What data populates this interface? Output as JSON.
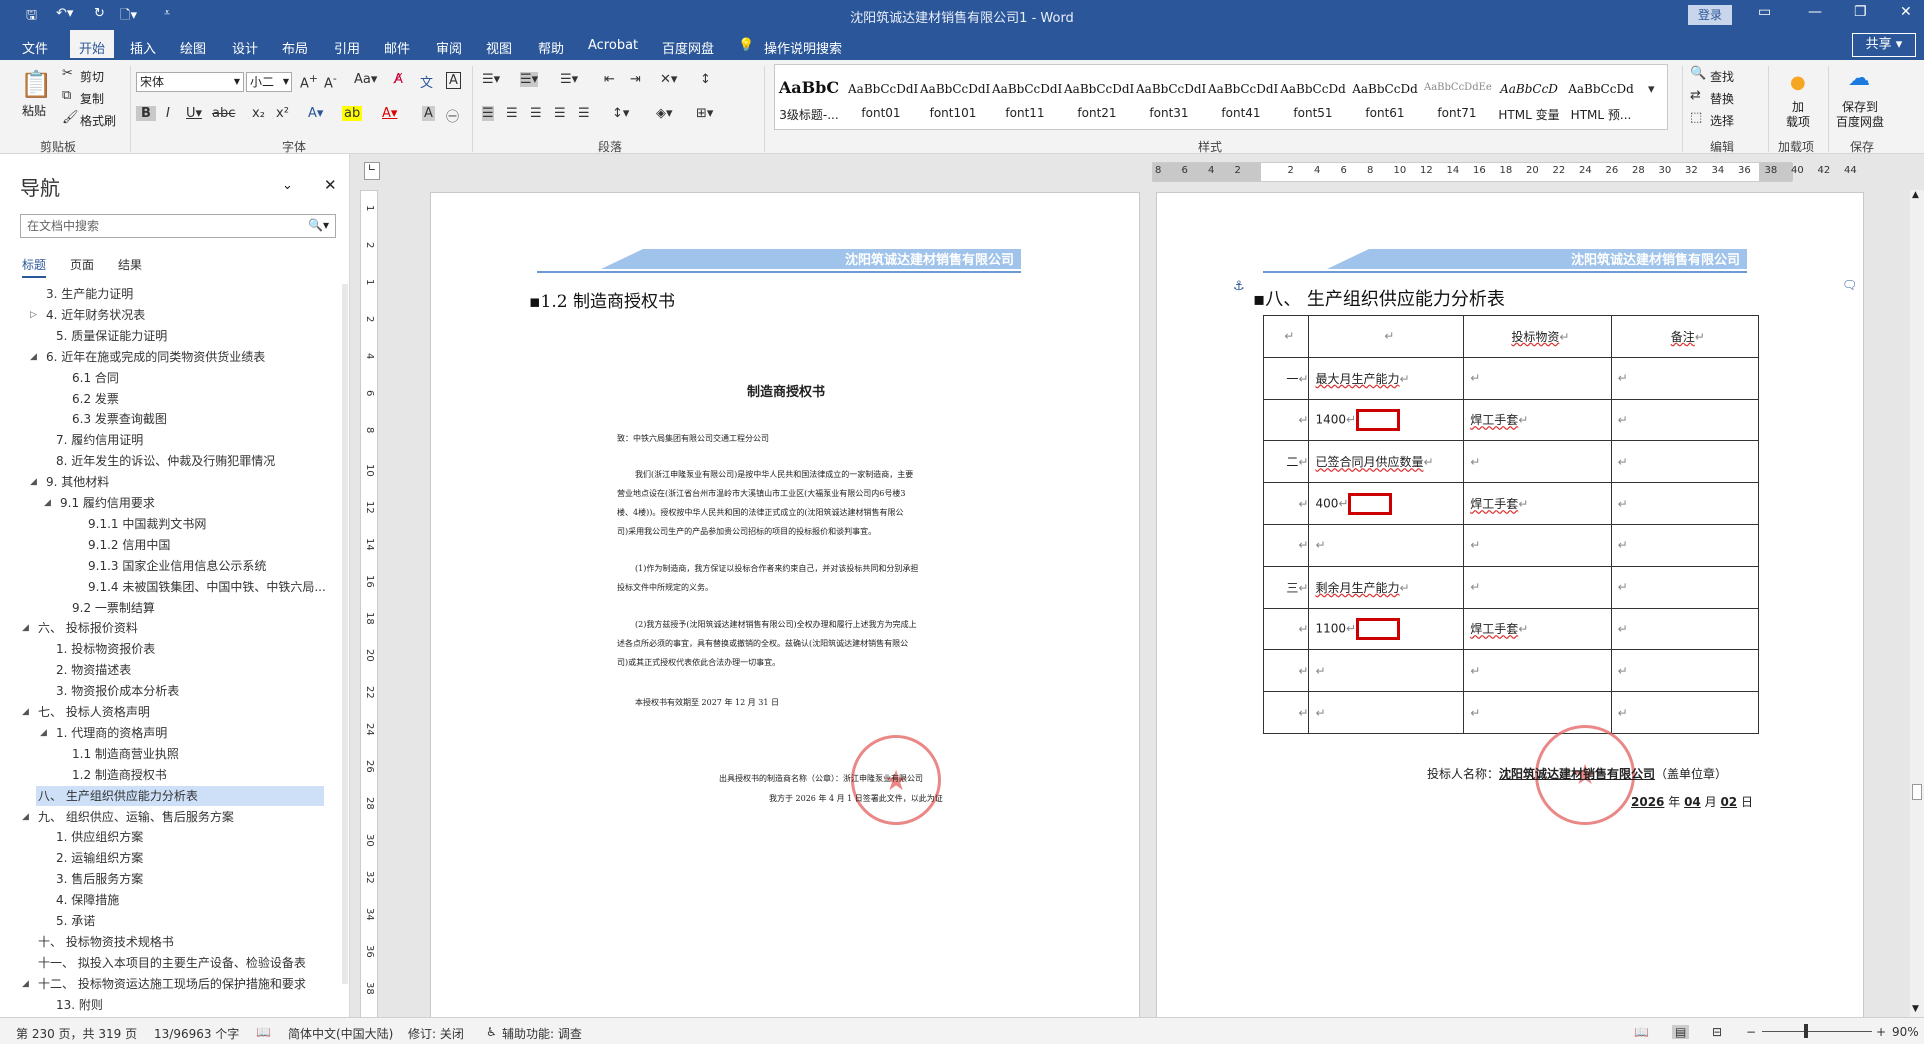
{
  "window": {
    "title": "沈阳筑诚达建材销售有限公司1 - Word",
    "login": "登录"
  },
  "tabs": [
    "文件",
    "开始",
    "插入",
    "绘图",
    "设计",
    "布局",
    "引用",
    "邮件",
    "审阅",
    "视图",
    "帮助",
    "Acrobat",
    "百度网盘"
  ],
  "tell_me": "操作说明搜索",
  "share": "共享",
  "ribbon": {
    "clipboard": {
      "paste": "粘贴",
      "cut": "剪切",
      "copy": "复制",
      "format_painter": "格式刷",
      "label": "剪贴板"
    },
    "font": {
      "name": "宋体",
      "size": "小二",
      "label": "字体"
    },
    "paragraph": {
      "label": "段落"
    },
    "styles": {
      "label": "样式",
      "items": [
        {
          "preview": "AaBbC",
          "name": "3级标题-..."
        },
        {
          "preview": "AaBbCcDdI",
          "name": "font01"
        },
        {
          "preview": "AaBbCcDdI",
          "name": "font101"
        },
        {
          "preview": "AaBbCcDdI",
          "name": "font11"
        },
        {
          "preview": "AaBbCcDdI",
          "name": "font21"
        },
        {
          "preview": "AaBbCcDdI",
          "name": "font31"
        },
        {
          "preview": "AaBbCcDdI",
          "name": "font41"
        },
        {
          "preview": "AaBbCcDd",
          "name": "font51"
        },
        {
          "preview": "AaBbCcDd",
          "name": "font61"
        },
        {
          "preview": "AaBbCcDdEe",
          "name": "font71"
        },
        {
          "preview": "AaBbCcD",
          "name": "HTML 变量"
        },
        {
          "preview": "AaBbCcDd",
          "name": "HTML 预..."
        }
      ]
    },
    "editing": {
      "find": "查找",
      "replace": "替换",
      "select": "选择",
      "label": "编辑"
    },
    "addins": {
      "load": "加\n载项",
      "label": "加载项"
    },
    "save": {
      "save_to_baidu": "保存到\n百度网盘",
      "label": "保存"
    }
  },
  "nav": {
    "title": "导航",
    "search_placeholder": "在文档中搜索",
    "tabs": [
      "标题",
      "页面",
      "结果"
    ],
    "items": [
      "3. 生产能力证明",
      "4. 近年财务状况表",
      "5. 质量保证能力证明",
      "6. 近年在施或完成的同类物资供货业绩表",
      "6.1 合同",
      "6.2 发票",
      "6.3 发票查询截图",
      "7. 履约信用证明",
      "8. 近年发生的诉讼、仲裁及行贿犯罪情况",
      "9. 其他材料",
      "9.1 履约信用要求",
      "9.1.1 中国裁判文书网",
      "9.1.2 信用中国",
      "9.1.3 国家企业信用信息公示系统",
      "9.1.4 未被国铁集团、中国中铁、中铁六局...",
      "9.2 一票制结算",
      "六、 投标报价资料",
      "1. 投标物资报价表",
      "2. 物资描述表",
      "3. 物资报价成本分析表",
      "七、 投标人资格声明",
      "1. 代理商的资格声明",
      "1.1 制造商营业执照",
      "1.2 制造商授权书",
      "八、 生产组织供应能力分析表",
      "九、 组织供应、运输、售后服务方案",
      "1. 供应组织方案",
      "2. 运输组织方案",
      "3. 售后服务方案",
      "4. 保障措施",
      "5. 承诺",
      "十、 投标物资技术规格书",
      "十一、 拟投入本项目的主要生产设备、检验设备表",
      "十二、 投标物资运达施工现场后的保护措施和要求",
      "13. 附则"
    ]
  },
  "page1": {
    "header": "沈阳筑诚达建材销售有限公司",
    "heading": "1.2  制造商授权书",
    "doc_title": "制造商授权书",
    "to": "致：中铁六局集团有限公司交通工程分公司",
    "p1": [
      "我们(浙江申隆泵业有限公司)是按中华人民共和国法律成立的一家制造商，主要",
      "营业地点设在(浙江省台州市温岭市大溪镇山市工业区(大福泵业有限公司内6号楼3",
      "楼、4楼))。授权按中华人民共和国的法律正式成立的(沈阳筑诚达建材销售有限公",
      "司)采用我公司生产的产品参加贵公司招标的项目的投标报价和谈判事宜。"
    ],
    "p2": [
      "(1)作为制造商，我方保证以投标合作者来约束自己，并对该投标共同和分别承担",
      "投标文件中所规定的义务。"
    ],
    "p3": [
      "(2)我方兹授予(沈阳筑诚达建材销售有限公司)全权办理和履行上述我方为完成上",
      "述各点所必须的事宜，具有替换或撤销的全权。兹确认(沈阳筑诚达建材销售有限公",
      "司)或其正式授权代表依此合法办理一切事宜。"
    ],
    "validity": "本授权书有效期至 2027 年 12 月 31 日",
    "sign1": "出具授权书的制造商名称（公章）：浙江申隆泵业有限公司",
    "sign2": "我方于 2026 年 4 月 1 日签署此文件，以此为证"
  },
  "page2": {
    "header": "沈阳筑诚达建材销售有限公司",
    "heading": "八、 生产组织供应能力分析表",
    "table": {
      "headers": [
        "",
        "",
        "投标物资",
        "备注"
      ],
      "rows": [
        [
          "一",
          "最大月生产能力",
          "",
          ""
        ],
        [
          "",
          "1400",
          "焊工手套",
          ""
        ],
        [
          "二",
          "已签合同月供应数量",
          "",
          ""
        ],
        [
          "",
          "400",
          "焊工手套",
          ""
        ],
        [
          "",
          "",
          "",
          ""
        ],
        [
          "三",
          "剩余月生产能力",
          "",
          ""
        ],
        [
          "",
          "1100",
          "焊工手套",
          ""
        ],
        [
          "",
          "",
          "",
          ""
        ],
        [
          "",
          "",
          "",
          ""
        ]
      ]
    },
    "bidder_label": "投标人名称：",
    "bidder_name": "沈阳筑诚达建材销售有限公司",
    "bidder_suffix": "（盖单位章）",
    "date": [
      "2026",
      "年",
      "04",
      "月",
      "02",
      "日"
    ]
  },
  "status": {
    "page": "第 230 页，共 319 页",
    "words": "13/96963 个字",
    "lang": "简体中文(中国大陆)",
    "track": "修订: 关闭",
    "accessibility": "辅助功能: 调查",
    "zoom": "90%"
  }
}
